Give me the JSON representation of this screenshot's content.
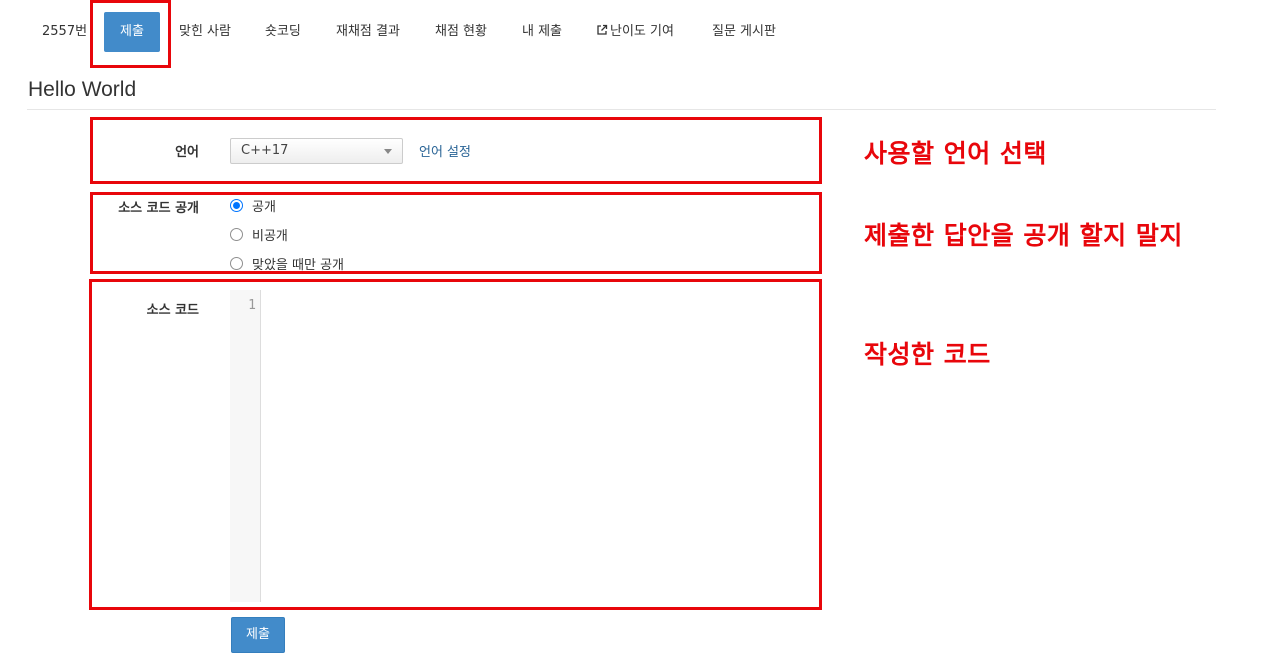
{
  "nav": {
    "items": [
      {
        "label": "2557번"
      },
      {
        "label": "제출"
      },
      {
        "label": "맞힌 사람"
      },
      {
        "label": "숏코딩"
      },
      {
        "label": "재채점 결과"
      },
      {
        "label": "채점 현황"
      },
      {
        "label": "내 제출"
      },
      {
        "label": "난이도 기여",
        "icon": "external-link-icon"
      },
      {
        "label": "질문 게시판"
      }
    ],
    "active_color": "#428bca"
  },
  "page_title": "Hello World",
  "form": {
    "language": {
      "label": "언어",
      "selected": "C++17",
      "settings_link": "언어 설정"
    },
    "visibility": {
      "label": "소스 코드 공개",
      "options": [
        {
          "label": "공개",
          "checked": true
        },
        {
          "label": "비공개",
          "checked": false
        },
        {
          "label": "맞았을 때만 공개",
          "checked": false
        }
      ]
    },
    "source": {
      "label": "소스 코드",
      "line_numbers": [
        "1"
      ]
    },
    "submit_label": "제출"
  },
  "annotations": {
    "color": "#e8060b",
    "language_note": "사용할 언어 선택",
    "visibility_note": "제출한 답안을 공개 할지 말지",
    "code_note": "작성한 코드"
  }
}
